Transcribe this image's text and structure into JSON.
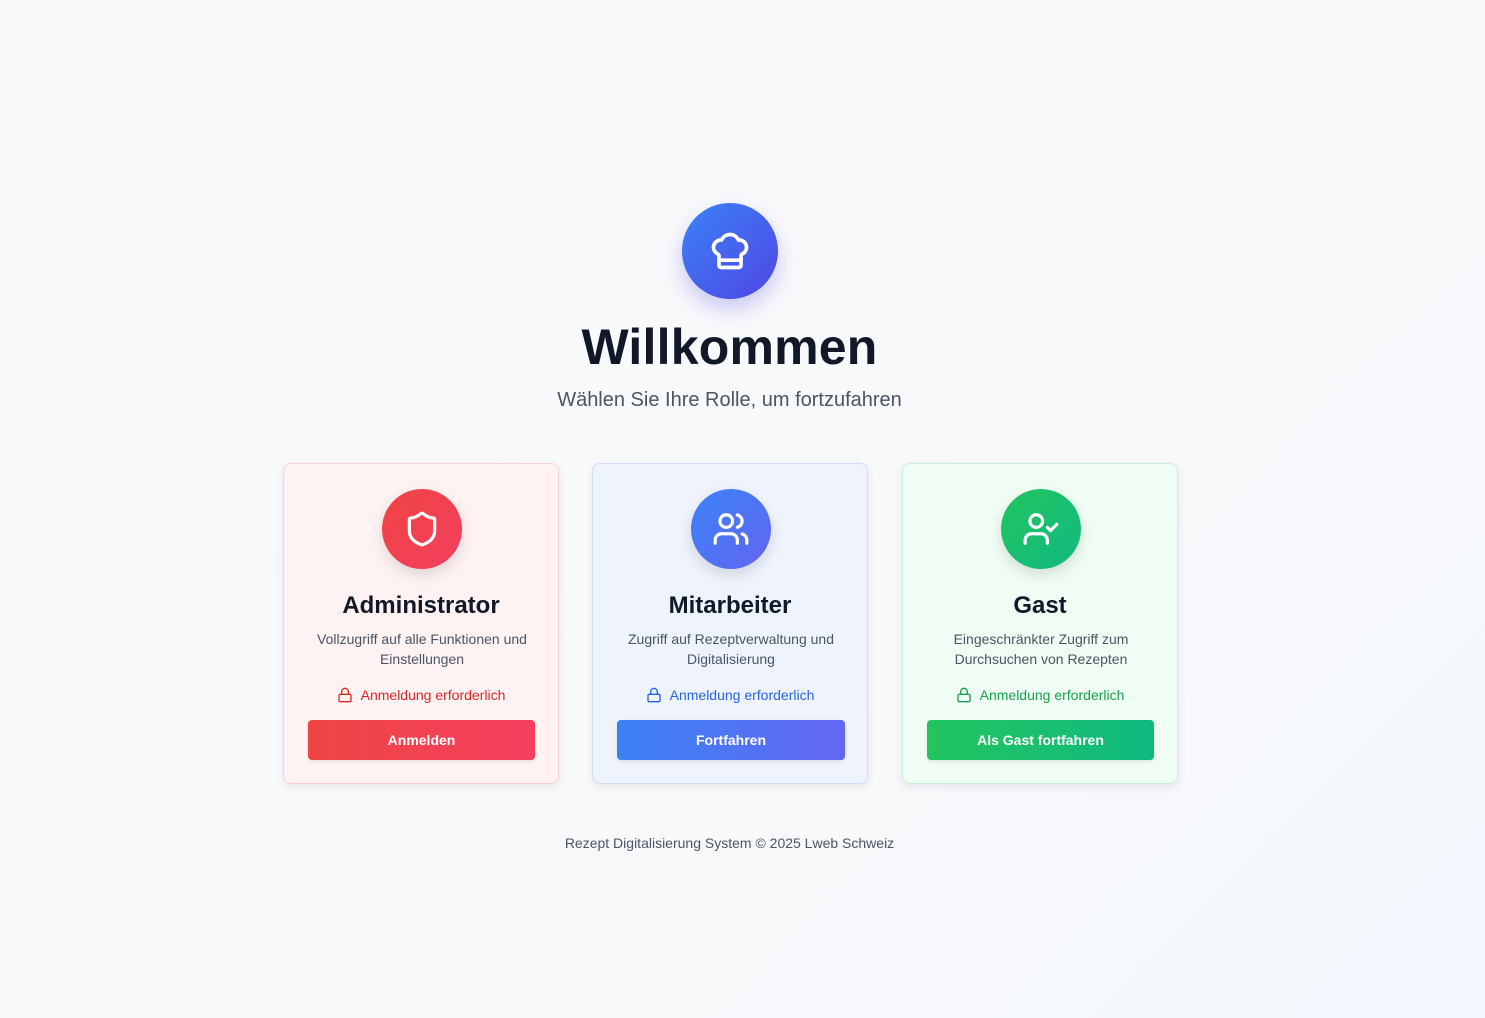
{
  "header": {
    "logo_icon": "chef-hat-icon",
    "title": "Willkommen",
    "subtitle": "Wählen Sie Ihre Rolle, um fortzufahren"
  },
  "roles": [
    {
      "icon": "shield-icon",
      "title": "Administrator",
      "description": "Vollzugriff auf alle Funktionen und Einstellungen",
      "lock_text": "Anmeldung erforderlich",
      "button_label": "Anmelden",
      "accent": "#ef4444"
    },
    {
      "icon": "users-icon",
      "title": "Mitarbeiter",
      "description": "Zugriff auf Rezeptverwaltung und Digitalisierung",
      "lock_text": "Anmeldung erforderlich",
      "button_label": "Fortfahren",
      "accent": "#3b82f6"
    },
    {
      "icon": "user-check-icon",
      "title": "Gast",
      "description": "Eingeschränkter Zugriff zum Durchsuchen von Rezepten",
      "lock_text": "Anmeldung erforderlich",
      "button_label": "Als Gast fortfahren",
      "accent": "#22c55e"
    }
  ],
  "footer": {
    "text": "Rezept Digitalisierung System © 2025 Lweb Schweiz"
  }
}
